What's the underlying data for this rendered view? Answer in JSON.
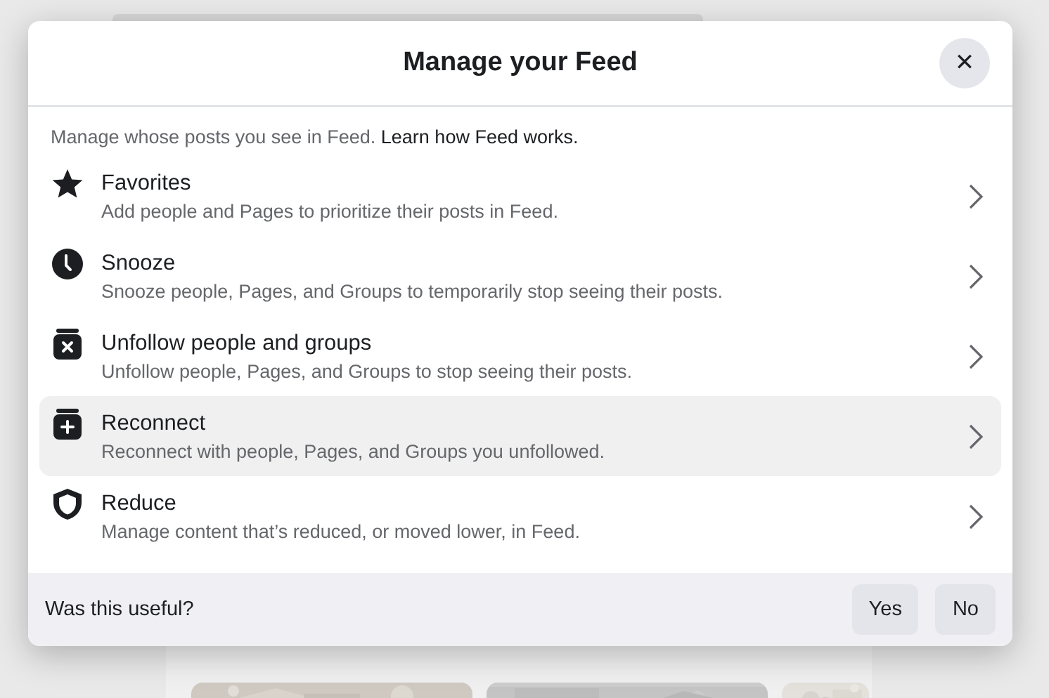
{
  "dialog": {
    "title": "Manage your Feed",
    "close_label": "✕"
  },
  "intro": {
    "text": "Manage whose posts you see in Feed.",
    "link": "Learn how Feed works."
  },
  "items": [
    {
      "kind": "star",
      "title": "Favorites",
      "description": "Add people and Pages to prioritize their posts in Feed.",
      "selected": false
    },
    {
      "kind": "clock",
      "title": "Snooze",
      "description": "Snooze people, Pages, and Groups to temporarily stop seeing their posts.",
      "selected": false
    },
    {
      "kind": "unfollow",
      "title": "Unfollow people and groups",
      "description": "Unfollow people, Pages, and Groups to stop seeing their posts.",
      "selected": false
    },
    {
      "kind": "reconnect",
      "title": "Reconnect",
      "description": "Reconnect with people, Pages, and Groups you unfollowed.",
      "selected": true
    },
    {
      "kind": "shield",
      "title": "Reduce",
      "description": "Manage content that’s reduced, or moved lower, in Feed.",
      "selected": false
    }
  ],
  "feedback": {
    "question": "Was this useful?",
    "buttons": [
      "Yes",
      "No"
    ]
  }
}
